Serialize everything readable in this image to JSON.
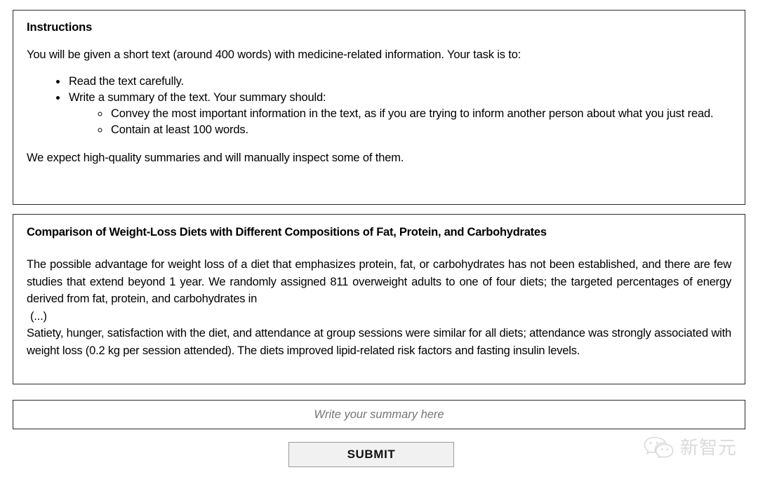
{
  "instructions": {
    "heading": "Instructions",
    "intro": "You will be given a short text (around 400 words) with medicine-related information. Your task is to:",
    "bullets": [
      {
        "text": "Read the text carefully.",
        "sub": []
      },
      {
        "text": "Write a summary of the text. Your summary should:",
        "sub": [
          "Convey the most important information in the text, as if you are trying to inform another person about what you just read.",
          "Contain at least 100 words."
        ]
      }
    ],
    "closing": "We expect high-quality summaries and will manually inspect some of them."
  },
  "article": {
    "title": "Comparison of Weight-Loss Diets with Different Compositions of Fat, Protein, and Carbohydrates",
    "paragraph1": "The possible advantage for weight loss of a diet that emphasizes protein, fat, or carbohydrates has not been established, and there are few studies that extend beyond 1 year. We randomly assigned 811 overweight adults to one of four diets; the targeted percentages of energy derived from fat, protein, and carbohydrates in",
    "truncation": "(...)",
    "paragraph2": "Satiety, hunger, satisfaction with the diet, and attendance at group sessions were similar for all diets; attendance was strongly associated with weight loss (0.2 kg per session attended). The diets improved lipid-related risk factors and fasting insulin levels."
  },
  "summary_input": {
    "placeholder": "Write your summary here",
    "value": ""
  },
  "submit": {
    "label": "SUBMIT"
  },
  "watermark": {
    "text": "新智元",
    "icon": "wechat-logo-icon"
  },
  "colors": {
    "panel_border": "#2b2b2b",
    "button_fill": "#f1f1f1",
    "button_border": "#9a9a9a",
    "placeholder_text": "#6d6d6d",
    "watermark_text": "#8e8e8e",
    "body_text": "#000000",
    "page_background": "#ffffff"
  }
}
